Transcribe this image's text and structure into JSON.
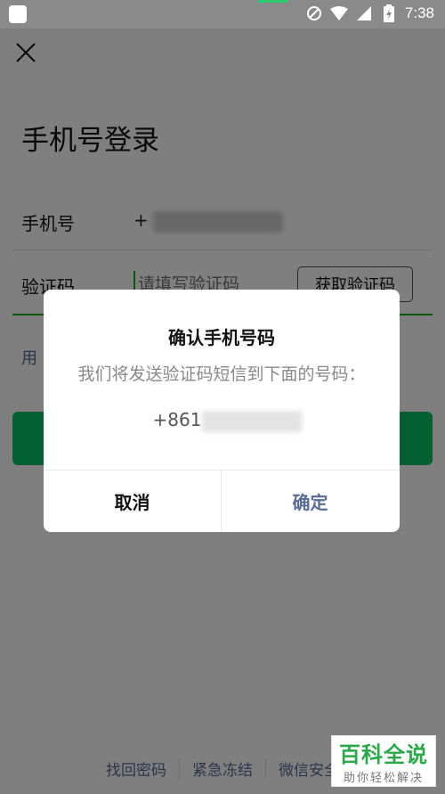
{
  "status_bar": {
    "time": "7:38",
    "icons": [
      "app-icon",
      "no-disturb-icon",
      "wifi-icon",
      "signal-icon",
      "battery-icon"
    ]
  },
  "page": {
    "title": "手机号登录",
    "phone_label": "手机号",
    "phone_value_prefix": "+",
    "code_label": "验证码",
    "code_placeholder": "请填写验证码",
    "get_code_button": "获取验证码",
    "alt_link": "用"
  },
  "footer": {
    "links": [
      "找回密码",
      "紧急冻结",
      "微信安全"
    ]
  },
  "dialog": {
    "title": "确认手机号码",
    "message": "我们将发送验证码短信到下面的号码：",
    "phone_prefix": "+861",
    "cancel": "取消",
    "confirm": "确定"
  },
  "watermark": {
    "main": "百科全说",
    "sub": "助你轻松解决"
  },
  "colors": {
    "accent": "#07c160",
    "link": "#576b95",
    "overlay": "rgba(0,0,0,0.5)"
  }
}
